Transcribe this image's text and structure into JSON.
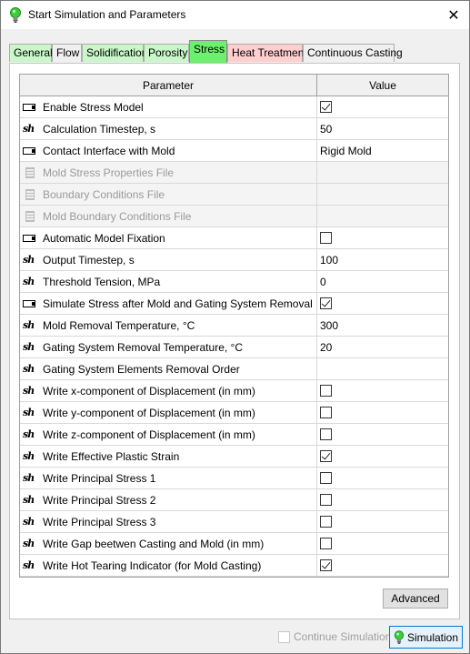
{
  "window": {
    "title": "Start Simulation and Parameters",
    "close_label": "✕"
  },
  "tabs": [
    {
      "label": "General",
      "state": "green"
    },
    {
      "label": "Flow",
      "state": "plain"
    },
    {
      "label": "Solidification",
      "state": "green"
    },
    {
      "label": "Porosity",
      "state": "green"
    },
    {
      "label": "Stress",
      "state": "active"
    },
    {
      "label": "Heat Treatment",
      "state": "pink"
    },
    {
      "label": "Continuous Casting",
      "state": "plain"
    }
  ],
  "grid": {
    "header_param": "Parameter",
    "header_value": "Value",
    "rows": [
      {
        "icon": "toggle-icon",
        "label": "Enable Stress Model",
        "type": "checkbox",
        "checked": true,
        "disabled": false
      },
      {
        "icon": "numeric-icon",
        "label": "Calculation Timestep, s",
        "type": "text",
        "value": "50",
        "disabled": false
      },
      {
        "icon": "toggle-icon",
        "label": "Contact Interface with Mold",
        "type": "text",
        "value": "Rigid Mold",
        "disabled": false
      },
      {
        "icon": "file-icon",
        "label": "Mold Stress Properties File",
        "type": "text",
        "value": "",
        "disabled": true
      },
      {
        "icon": "file-icon",
        "label": "Boundary Conditions File",
        "type": "text",
        "value": "",
        "disabled": true
      },
      {
        "icon": "file-icon",
        "label": "Mold Boundary Conditions File",
        "type": "text",
        "value": "",
        "disabled": true
      },
      {
        "icon": "toggle-icon",
        "label": "Automatic Model Fixation",
        "type": "checkbox",
        "checked": false,
        "disabled": false
      },
      {
        "icon": "numeric-icon",
        "label": "Output Timestep, s",
        "type": "text",
        "value": "100",
        "disabled": false
      },
      {
        "icon": "numeric-icon",
        "label": "Threshold Tension, MPa",
        "type": "text",
        "value": "0",
        "disabled": false
      },
      {
        "icon": "toggle-icon",
        "label": "Simulate Stress after Mold and Gating System Removal",
        "type": "checkbox",
        "checked": true,
        "disabled": false
      },
      {
        "icon": "numeric-icon",
        "label": "Mold Removal Temperature, °C",
        "type": "text",
        "value": "300",
        "disabled": false
      },
      {
        "icon": "numeric-icon",
        "label": "Gating System Removal Temperature, °C",
        "type": "text",
        "value": "20",
        "disabled": false
      },
      {
        "icon": "numeric-icon",
        "label": "Gating System Elements Removal Order",
        "type": "text",
        "value": "",
        "disabled": false
      },
      {
        "icon": "numeric-icon",
        "label": "Write x-component of Displacement (in mm)",
        "type": "checkbox",
        "checked": false,
        "disabled": false
      },
      {
        "icon": "numeric-icon",
        "label": "Write y-component of Displacement (in mm)",
        "type": "checkbox",
        "checked": false,
        "disabled": false
      },
      {
        "icon": "numeric-icon",
        "label": "Write z-component of Displacement (in mm)",
        "type": "checkbox",
        "checked": false,
        "disabled": false
      },
      {
        "icon": "numeric-icon",
        "label": "Write Effective Plastic Strain",
        "type": "checkbox",
        "checked": true,
        "disabled": false
      },
      {
        "icon": "numeric-icon",
        "label": "Write Principal Stress 1",
        "type": "checkbox",
        "checked": false,
        "disabled": false
      },
      {
        "icon": "numeric-icon",
        "label": "Write Principal Stress 2",
        "type": "checkbox",
        "checked": false,
        "disabled": false
      },
      {
        "icon": "numeric-icon",
        "label": "Write Principal Stress 3",
        "type": "checkbox",
        "checked": false,
        "disabled": false
      },
      {
        "icon": "numeric-icon",
        "label": "Write Gap beetwen Casting and Mold (in mm)",
        "type": "checkbox",
        "checked": false,
        "disabled": false
      },
      {
        "icon": "numeric-icon",
        "label": "Write Hot Tearing Indicator (for Mold Casting)",
        "type": "checkbox",
        "checked": true,
        "disabled": false
      }
    ]
  },
  "icon_glyphs": {
    "numeric": "𝒔𝒉"
  },
  "buttons": {
    "advanced_label": "Advanced",
    "continue_label": "Continue Simulation",
    "continue_checked": false,
    "simulation_label": "Simulation"
  },
  "colors": {
    "tab_active": "#6fef6f",
    "tab_green": "#c9f7c9",
    "tab_pink": "#ffcece",
    "sim_button_border": "#0078d7"
  }
}
